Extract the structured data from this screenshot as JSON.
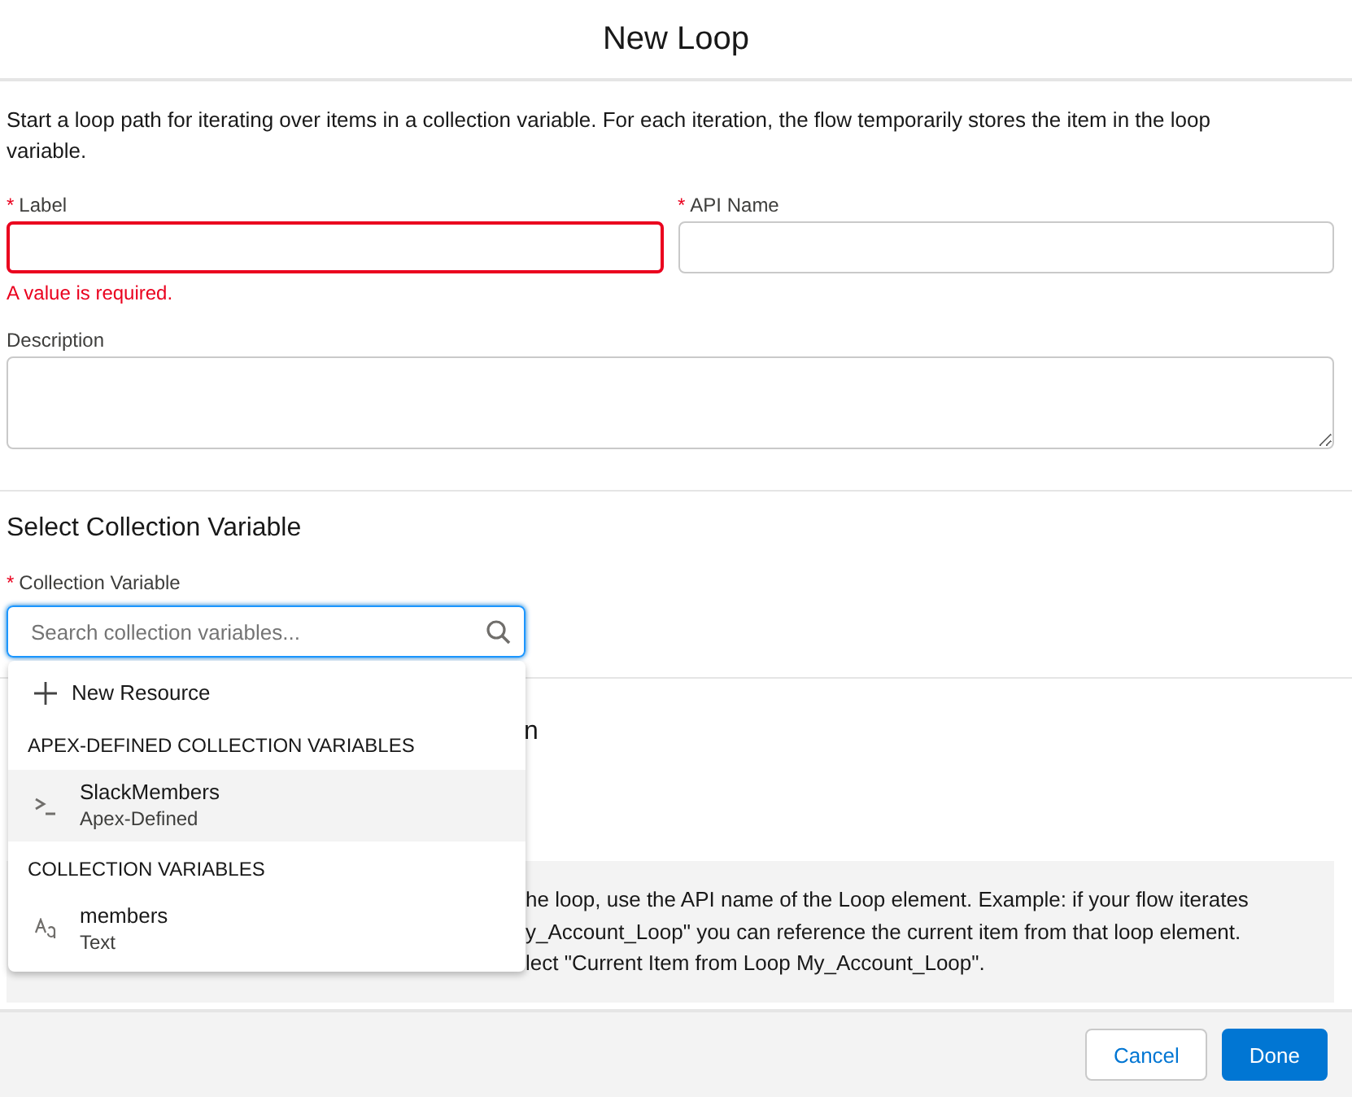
{
  "modal": {
    "title": "New Loop"
  },
  "intro": "Start a loop path for iterating over items in a collection variable. For each iteration, the flow temporarily stores the item in the loop variable.",
  "fields": [
    {
      "label": "Label",
      "required_mark": "*",
      "invalid": true,
      "error": "A value is required."
    },
    {
      "label": "API Name",
      "required_mark": "*",
      "invalid": false
    }
  ],
  "description": {
    "label": "Description"
  },
  "collection_section": {
    "heading": "Select Collection Variable",
    "field_label": "Collection Variable",
    "required_mark": "*",
    "placeholder": "Search collection variables..."
  },
  "dropdown": {
    "items": [
      {
        "kind": "action",
        "label": "New Resource"
      },
      {
        "kind": "header",
        "label": "APEX-DEFINED COLLECTION VARIABLES"
      },
      {
        "kind": "option",
        "label": "SlackMembers",
        "sublabel": "Apex-Defined",
        "selected": true
      },
      {
        "kind": "header",
        "label": "COLLECTION VARIABLES"
      },
      {
        "kind": "option",
        "label": "members",
        "sublabel": "Text",
        "selected": false
      }
    ]
  },
  "hidden_section": {
    "heading_tail": "n",
    "info_lines": [
      "he loop, use the API name of the Loop element. Example: if your flow iterates",
      "y_Account_Loop\" you can reference the current item from that loop element.",
      "lect \"Current Item from Loop My_Account_Loop\"."
    ]
  },
  "footer": {
    "buttons": [
      {
        "label": "Cancel",
        "kind": "neutral"
      },
      {
        "label": "Done",
        "kind": "brand"
      }
    ]
  }
}
